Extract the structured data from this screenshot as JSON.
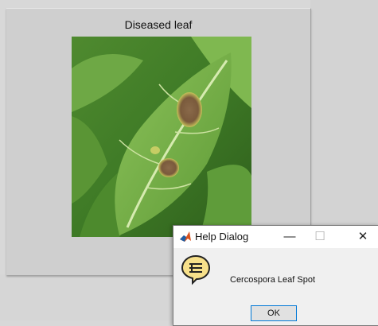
{
  "figure": {
    "title": "Diseased leaf"
  },
  "dialog": {
    "title": "Help Dialog",
    "message": "Cercospora Leaf Spot",
    "ok_label": "OK",
    "minimize_glyph": "—",
    "maximize_glyph": "☐",
    "close_glyph": "✕",
    "app_icon": "matlab-icon",
    "message_icon": "help-icon"
  },
  "colors": {
    "accent": "#0078d7",
    "help_icon_fill": "#f7e08a"
  }
}
